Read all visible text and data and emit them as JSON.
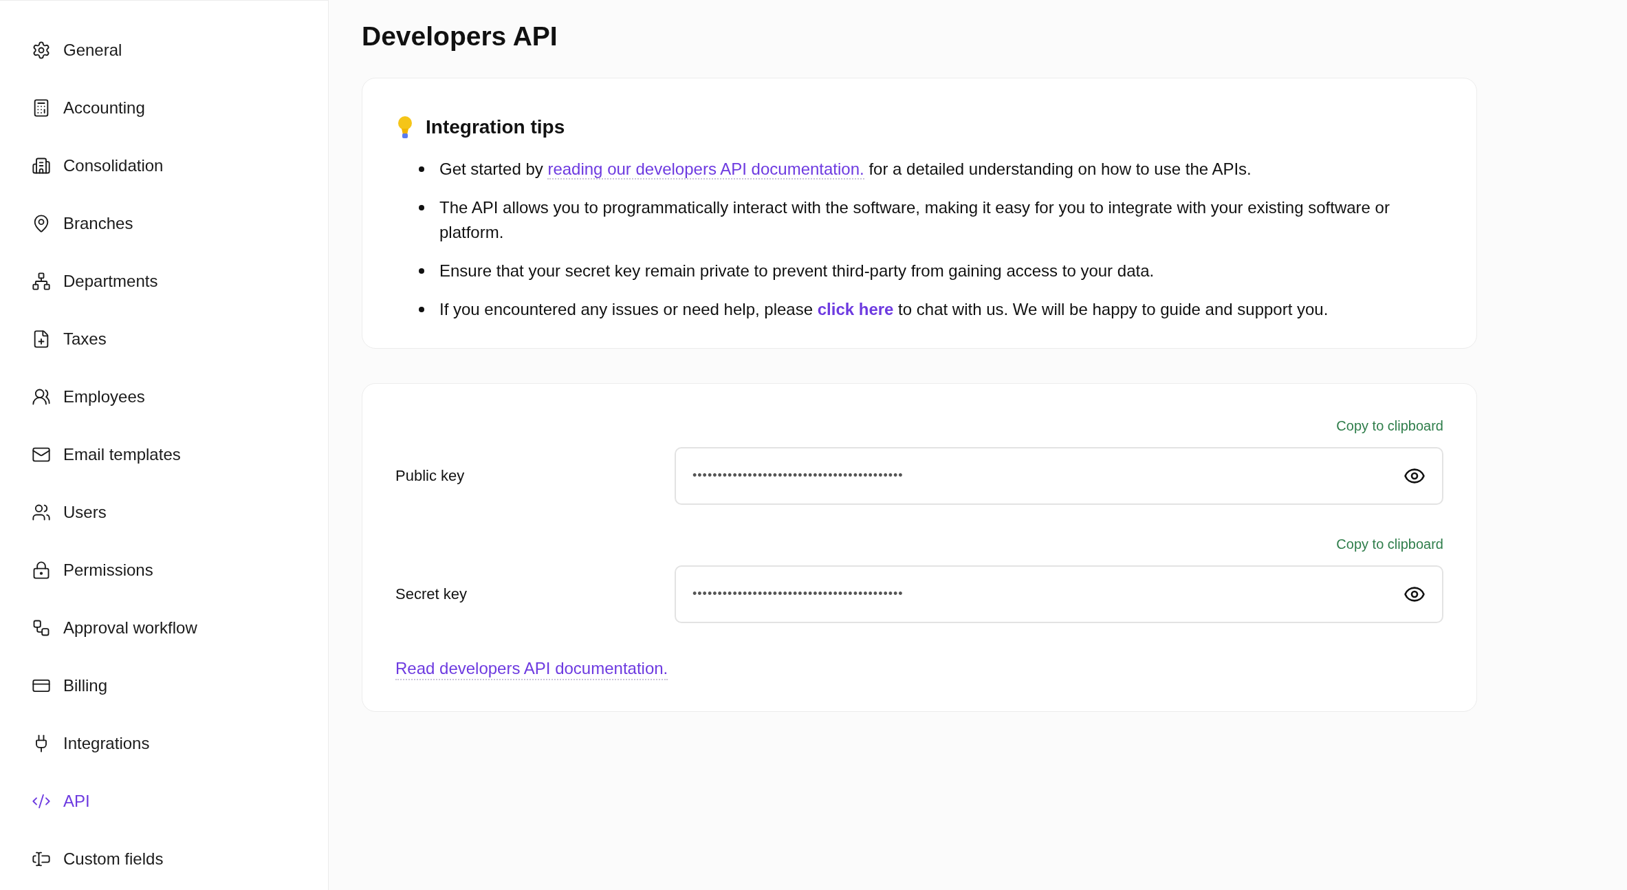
{
  "sidebar": {
    "items": [
      {
        "label": "General",
        "selected": false
      },
      {
        "label": "Accounting",
        "selected": false
      },
      {
        "label": "Consolidation",
        "selected": false
      },
      {
        "label": "Branches",
        "selected": false
      },
      {
        "label": "Departments",
        "selected": false
      },
      {
        "label": "Taxes",
        "selected": false
      },
      {
        "label": "Employees",
        "selected": false
      },
      {
        "label": "Email templates",
        "selected": false
      },
      {
        "label": "Users",
        "selected": false
      },
      {
        "label": "Permissions",
        "selected": false
      },
      {
        "label": "Approval workflow",
        "selected": false
      },
      {
        "label": "Billing",
        "selected": false
      },
      {
        "label": "Integrations",
        "selected": false
      },
      {
        "label": "API",
        "selected": true
      },
      {
        "label": "Custom fields",
        "selected": false
      }
    ]
  },
  "page_title": "Developers API",
  "tips": {
    "title": "Integration tips",
    "items": [
      [
        {
          "kind": "text",
          "text": "Get started by "
        },
        {
          "kind": "link",
          "text": "reading our developers API documentation."
        },
        {
          "kind": "text",
          "text": " for a detailed understanding on how to use the APIs."
        }
      ],
      [
        {
          "kind": "text",
          "text": "The API allows you to programmatically interact with the software, making it easy for you to integrate with your existing software or platform."
        }
      ],
      [
        {
          "kind": "text",
          "text": "Ensure that your secret key remain private to prevent third-party from gaining access to your data."
        }
      ],
      [
        {
          "kind": "text",
          "text": "If you encountered any issues or need help, please "
        },
        {
          "kind": "strong_link",
          "text": "click here"
        },
        {
          "kind": "text",
          "text": " to chat with us. We will be happy to guide and support you."
        }
      ]
    ]
  },
  "keys": [
    {
      "label": "Public key",
      "copy": "Copy to clipboard",
      "value": "••••••••••••••••••••••••••••••••••••••••••"
    },
    {
      "label": "Secret key",
      "copy": "Copy to clipboard",
      "value": "••••••••••••••••••••••••••••••••••••••••••"
    }
  ],
  "docs_link": "Read developers API documentation."
}
